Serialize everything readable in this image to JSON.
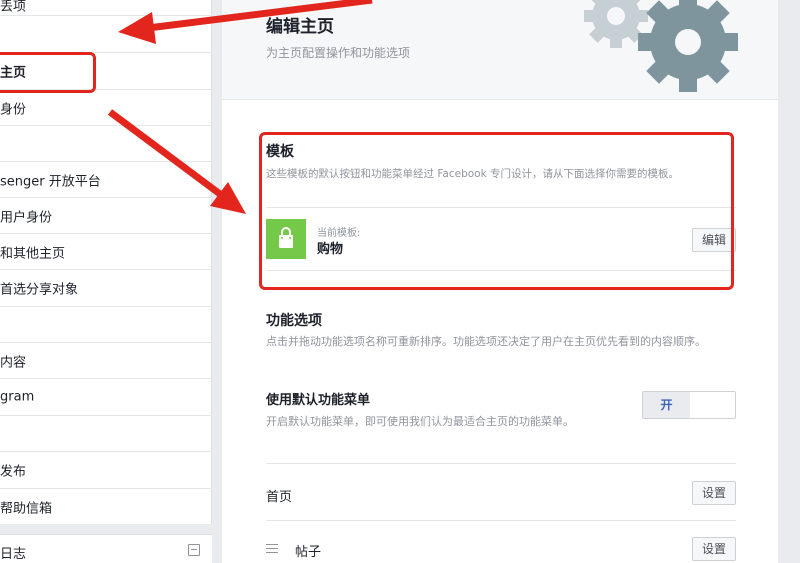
{
  "sidebar": {
    "items": [
      {
        "label": "丢项"
      },
      {
        "label": ""
      },
      {
        "label": "主页"
      },
      {
        "label": "身份"
      },
      {
        "label": ""
      },
      {
        "label": "senger 开放平台"
      },
      {
        "label": "用户身份"
      },
      {
        "label": "和其他主页"
      },
      {
        "label": "首选分享对象"
      },
      {
        "label": ""
      },
      {
        "label": "内容"
      },
      {
        "label": "gram"
      },
      {
        "label": ""
      },
      {
        "label": "发布"
      },
      {
        "label": "帮助信箱"
      }
    ],
    "bottom_label": "日志"
  },
  "header": {
    "title": "编辑主页",
    "subtitle": "为主页配置操作和功能选项"
  },
  "template_section": {
    "title": "模板",
    "description": "这些模板的默认按钮和功能菜单经过 Facebook 专门设计，请从下面选择你需要的模板。",
    "current_label": "当前模板:",
    "current_name": "购物",
    "edit_button": "编辑"
  },
  "features_section": {
    "title": "功能选项",
    "description": "点击并拖动功能选项名称可重新排序。功能选项还决定了用户在主页优先看到的内容顺序。",
    "default_menu": {
      "title": "使用默认功能菜单",
      "description": "开启默认功能菜单，即可使用我们认为最适合主页的功能菜单。",
      "toggle_label": "开"
    },
    "tabs": [
      {
        "label": "首页",
        "button": "设置"
      },
      {
        "label": "帖子",
        "button": "设置"
      }
    ]
  },
  "colors": {
    "annotation_red": "#e2261e",
    "template_green": "#74c948",
    "gear_gray": "#7f959e"
  }
}
